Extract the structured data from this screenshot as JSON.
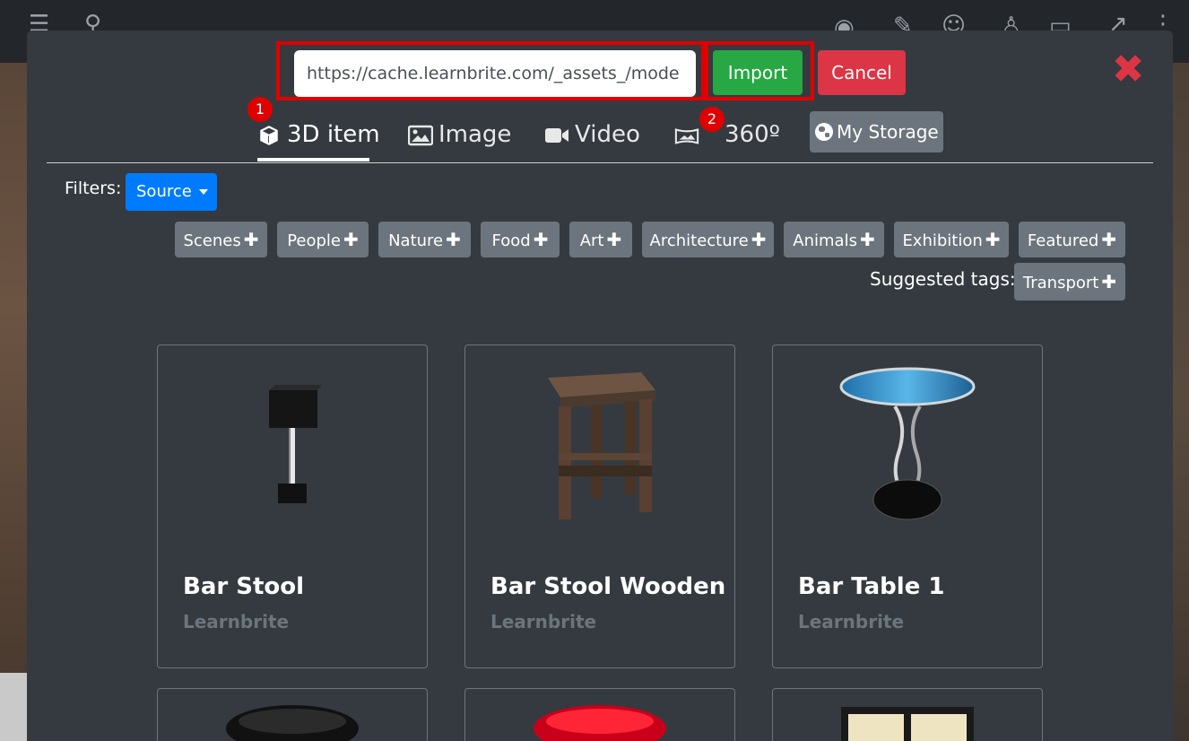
{
  "import_bar": {
    "url_value": "https://cache.learnbrite.com/_assets_/mode",
    "import_label": "Import",
    "cancel_label": "Cancel",
    "close_glyph": "✖"
  },
  "annotations": [
    "1",
    "2"
  ],
  "tabs": [
    {
      "label": "3D item",
      "icon": "cube-icon",
      "active": true
    },
    {
      "label": "Image",
      "icon": "image-icon",
      "active": false
    },
    {
      "label": "Video",
      "icon": "video-camera-icon",
      "active": false
    },
    {
      "label": "360º",
      "icon": "panorama-icon",
      "active": false
    }
  ],
  "storage": {
    "label": "My Storage",
    "icon": "globe-icon"
  },
  "filters": {
    "label": "Filters:",
    "source_label": "Source"
  },
  "tags": [
    "Scenes",
    "People",
    "Nature",
    "Food",
    "Art",
    "Architecture",
    "Animals",
    "Exhibition",
    "Featured"
  ],
  "suggested": {
    "label": "Suggested tags:",
    "tags": [
      "Transport"
    ]
  },
  "cards": [
    {
      "title": "Bar Stool",
      "source": "Learnbrite"
    },
    {
      "title": "Bar Stool Wooden",
      "source": "Learnbrite"
    },
    {
      "title": "Bar Table 1",
      "source": "Learnbrite"
    }
  ],
  "colors": {
    "accent": "#007bff",
    "success": "#28a745",
    "danger": "#dc3545",
    "tag": "#6c757d",
    "highlight": "#e00000"
  }
}
